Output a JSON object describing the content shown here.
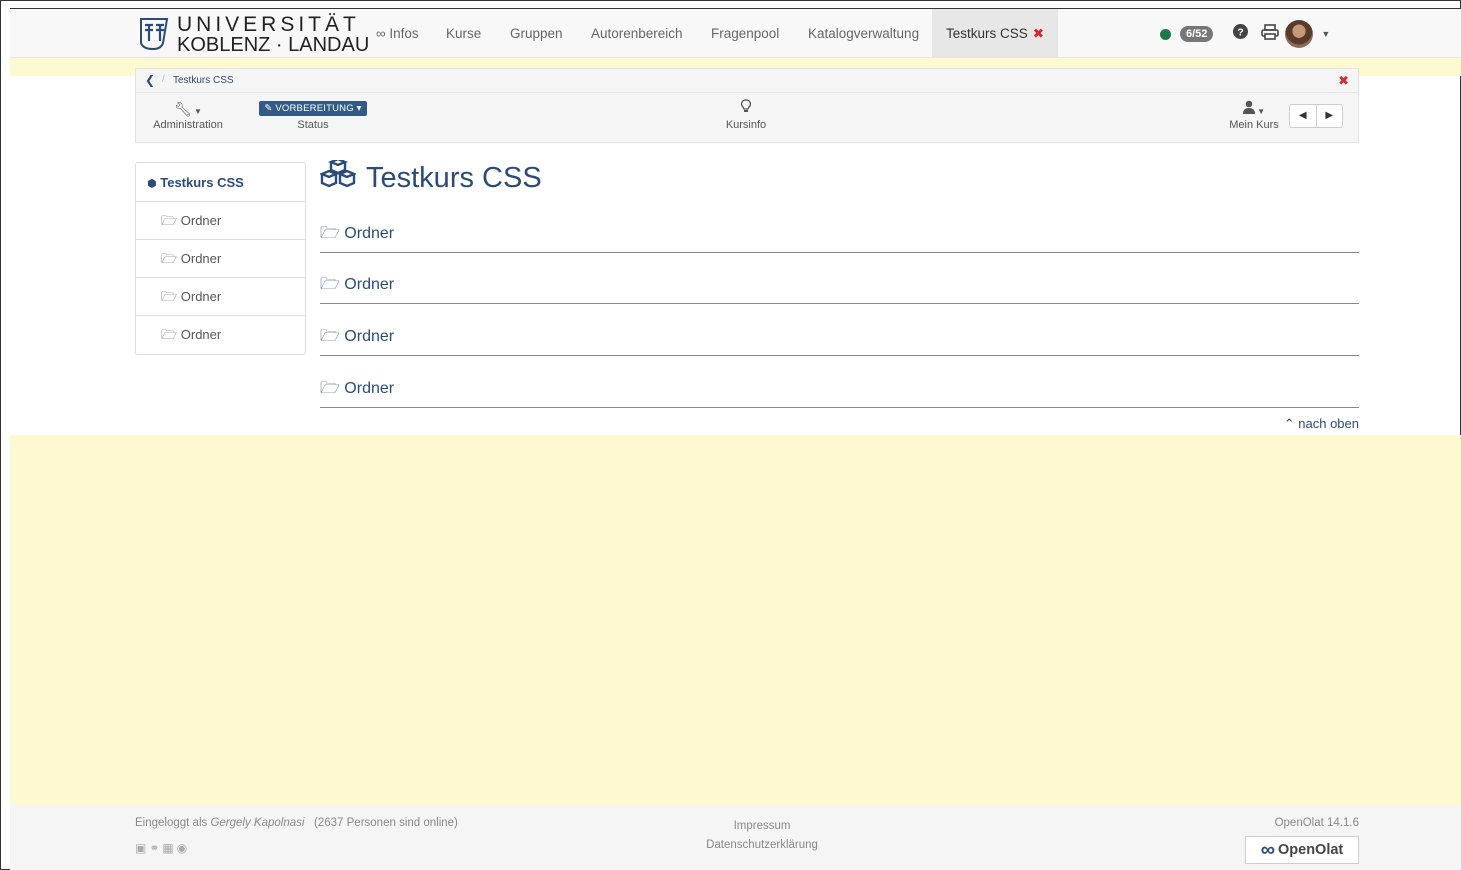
{
  "brand": {
    "line1": "UNIVERSITÄT",
    "line2": "KOBLENZ · LANDAU"
  },
  "topnav": {
    "items": [
      {
        "label": "∞ Infos"
      },
      {
        "label": "Kurse"
      },
      {
        "label": "Gruppen"
      },
      {
        "label": "Autorenbereich"
      },
      {
        "label": "Fragenpool"
      },
      {
        "label": "Katalogverwaltung"
      }
    ],
    "active_tab": {
      "label": "Testkurs CSS",
      "close": "✖"
    },
    "online_badge": "6/52"
  },
  "course": {
    "breadcrumb": "Testkurs CSS",
    "tools": {
      "administration": "Administration",
      "status_button": "VORBEREITUNG",
      "status": "Status",
      "kursinfo": "Kursinfo",
      "mein_kurs": "Mein Kurs"
    }
  },
  "menu": {
    "head": "Testkurs CSS",
    "items": [
      {
        "label": "Ordner"
      },
      {
        "label": "Ordner"
      },
      {
        "label": "Ordner"
      },
      {
        "label": "Ordner"
      }
    ]
  },
  "main": {
    "title": "Testkurs CSS",
    "rows": [
      {
        "label": "Ordner"
      },
      {
        "label": "Ordner"
      },
      {
        "label": "Ordner"
      },
      {
        "label": "Ordner"
      }
    ],
    "to_top": "nach oben"
  },
  "footer": {
    "logged_in_prefix": "Eingeloggt als",
    "user": "Gergely Kapolnasi",
    "online": "(2637 Personen sind online)",
    "impressum": "Impressum",
    "privacy": "Datenschutzerklärung",
    "version": "OpenOlat 14.1.6",
    "product": "OpenOlat"
  },
  "colors": {
    "link": "#2a4c7a",
    "accent_red": "#d9262a",
    "highlight": "#fef9d0",
    "online_dot": "#1d7a46"
  },
  "icons": [
    "uni-logo-icon",
    "wrench-icon",
    "pencil-icon",
    "lightbulb-icon",
    "user-icon",
    "cubes-icon",
    "folder-open-icon",
    "chevron-up-icon",
    "help-icon",
    "print-icon"
  ]
}
